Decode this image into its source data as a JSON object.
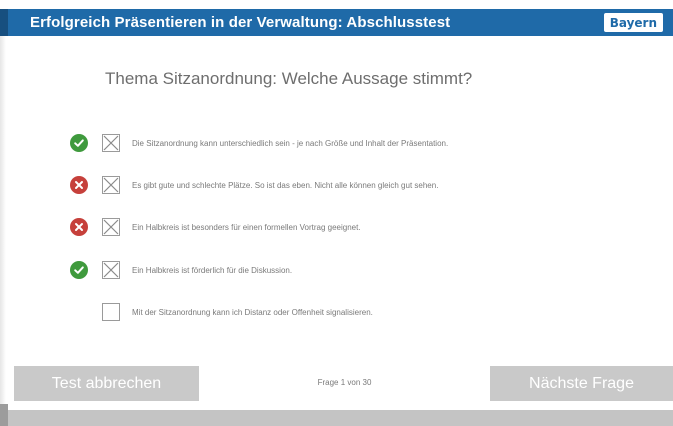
{
  "header": {
    "title": "Erfolgreich Präsentieren in der Verwaltung: Abschlusstest",
    "logo_text": "Bayern",
    "color": "#1f6aa8"
  },
  "question": "Thema Sitzanordnung: Welche Aussage stimmt?",
  "answers": [
    {
      "status": "correct",
      "status_icon": "check-circle-icon",
      "checked": true,
      "text": "Die Sitzanordnung kann unterschiedlich sein - je nach Größe und Inhalt der Präsentation."
    },
    {
      "status": "wrong",
      "status_icon": "x-circle-icon",
      "checked": true,
      "text": "Es gibt gute und schlechte Plätze. So ist das eben. Nicht alle können gleich gut sehen."
    },
    {
      "status": "wrong",
      "status_icon": "x-circle-icon",
      "checked": true,
      "text": "Ein Halbkreis ist besonders für einen formellen Vortrag geeignet."
    },
    {
      "status": "correct",
      "status_icon": "check-circle-icon",
      "checked": true,
      "text": "Ein Halbkreis ist förderlich für die Diskussion."
    },
    {
      "status": "none",
      "status_icon": "",
      "checked": false,
      "text": "Mit der Sitzanordnung kann ich Distanz oder Offenheit signalisieren."
    }
  ],
  "footer": {
    "cancel_label": "Test abbrechen",
    "next_label": "Nächste Frage",
    "page_indicator": "Frage 1 von 30"
  },
  "colors": {
    "correct": "#3f9a3d",
    "wrong": "#c6403b",
    "button_bg": "#c9c9c9"
  }
}
